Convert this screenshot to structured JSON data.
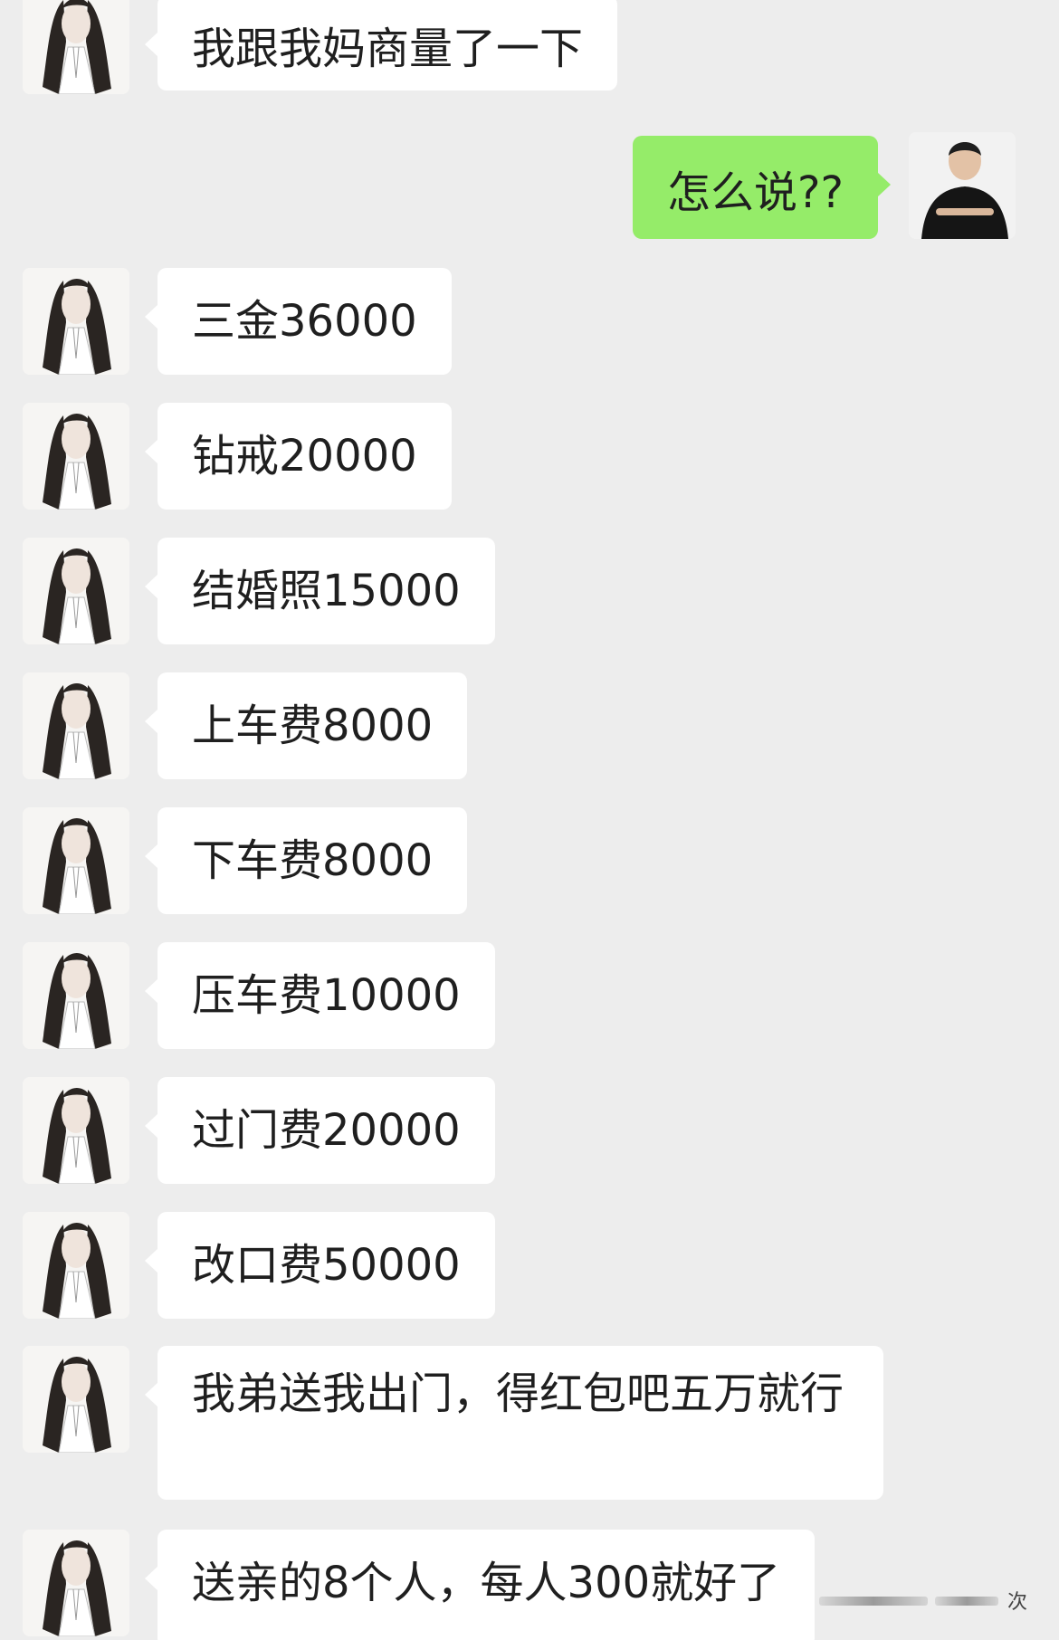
{
  "messages": [
    {
      "side": "left",
      "text": "我跟我妈商量了一下"
    },
    {
      "side": "right",
      "text": "怎么说??"
    },
    {
      "side": "left",
      "text": "三金36000"
    },
    {
      "side": "left",
      "text": "钻戒20000"
    },
    {
      "side": "left",
      "text": "结婚照15000"
    },
    {
      "side": "left",
      "text": "上车费8000"
    },
    {
      "side": "left",
      "text": "下车费8000"
    },
    {
      "side": "left",
      "text": "压车费10000"
    },
    {
      "side": "left",
      "text": "过门费20000"
    },
    {
      "side": "left",
      "text": "改口费50000"
    },
    {
      "side": "left",
      "text": "我弟送我出门，得红包吧五万就行"
    },
    {
      "side": "left",
      "text": "送亲的8个人，每人300就好了"
    }
  ],
  "colors": {
    "background": "#ededed",
    "incoming_bubble": "#ffffff",
    "outgoing_bubble": "#95ec69",
    "text": "#1f1f1f"
  },
  "icons": {
    "incoming_avatar": "woman-portrait-avatar",
    "outgoing_avatar": "man-portrait-avatar"
  }
}
